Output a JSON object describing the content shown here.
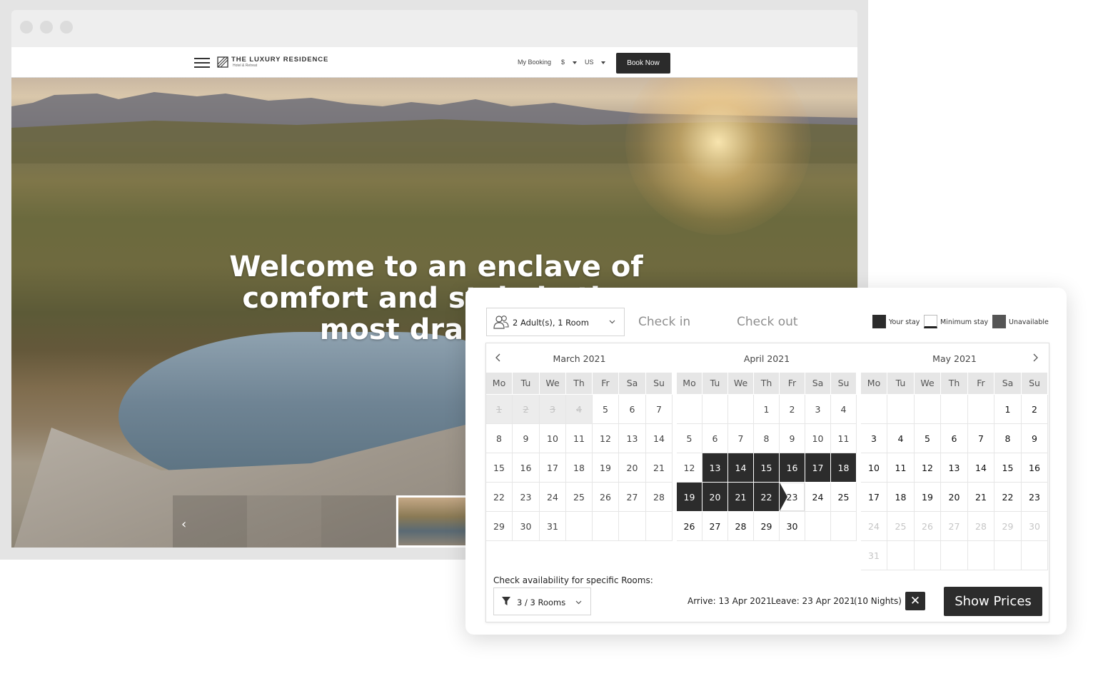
{
  "site": {
    "logo_title": "THE LUXURY RESIDENCE",
    "logo_subtitle": "Hotel & Retreat",
    "nav": {
      "my_booking": "My Booking",
      "currency": "$",
      "language": "US",
      "book_now": "Book Now"
    },
    "hero_title": "Welcome to an enclave of comfort and style in the most dramatic"
  },
  "booking": {
    "guests_label": "2 Adult(s), 1 Room",
    "check_in_placeholder": "Check in",
    "check_out_placeholder": "Check out",
    "legend": {
      "your_stay": "Your stay",
      "minimum_stay": "Minimum stay",
      "unavailable": "Unavailable"
    },
    "weekdays": [
      "Mo",
      "Tu",
      "We",
      "Th",
      "Fr",
      "Sa",
      "Su"
    ],
    "months": [
      {
        "title": "March 2021",
        "weeks": [
          [
            {
              "d": ""
            },
            {
              "d": "1",
              "s": "past"
            },
            {
              "d": "2",
              "s": "past"
            },
            {
              "d": "3",
              "s": "past"
            },
            {
              "d": "4",
              "s": "past"
            },
            {
              "d": "5"
            },
            {
              "d": "6"
            },
            {
              "d": "7"
            }
          ],
          [
            {
              "d": "8"
            },
            {
              "d": "9"
            },
            {
              "d": "10"
            },
            {
              "d": "11"
            },
            {
              "d": "12"
            },
            {
              "d": "13"
            },
            {
              "d": "14"
            }
          ],
          [
            {
              "d": "15"
            },
            {
              "d": "16"
            },
            {
              "d": "17"
            },
            {
              "d": "18"
            },
            {
              "d": "19"
            },
            {
              "d": "20"
            },
            {
              "d": "21"
            }
          ],
          [
            {
              "d": "22"
            },
            {
              "d": "23"
            },
            {
              "d": "24"
            },
            {
              "d": "25"
            },
            {
              "d": "26"
            },
            {
              "d": "27"
            },
            {
              "d": "28"
            }
          ],
          [
            {
              "d": "29"
            },
            {
              "d": "30"
            },
            {
              "d": "31"
            },
            {
              "d": ""
            },
            {
              "d": ""
            },
            {
              "d": ""
            },
            {
              "d": ""
            }
          ]
        ]
      },
      {
        "title": "April 2021",
        "weeks": [
          [
            {
              "d": ""
            },
            {
              "d": ""
            },
            {
              "d": ""
            },
            {
              "d": "1"
            },
            {
              "d": "2"
            },
            {
              "d": "3"
            },
            {
              "d": "4"
            }
          ],
          [
            {
              "d": "5"
            },
            {
              "d": "6"
            },
            {
              "d": "7"
            },
            {
              "d": "8"
            },
            {
              "d": "9"
            },
            {
              "d": "10"
            },
            {
              "d": "11"
            }
          ],
          [
            {
              "d": "12"
            },
            {
              "d": "13",
              "s": "stay"
            },
            {
              "d": "14",
              "s": "stay"
            },
            {
              "d": "15",
              "s": "stay"
            },
            {
              "d": "16",
              "s": "stay"
            },
            {
              "d": "17",
              "s": "stay"
            },
            {
              "d": "18",
              "s": "stay"
            }
          ],
          [
            {
              "d": "19",
              "s": "stay"
            },
            {
              "d": "20",
              "s": "stay"
            },
            {
              "d": "21",
              "s": "stay"
            },
            {
              "d": "22",
              "s": "stay"
            },
            {
              "d": "23",
              "s": "min"
            },
            {
              "d": "24",
              "s": "strong"
            },
            {
              "d": "25",
              "s": "strong"
            }
          ],
          [
            {
              "d": "26",
              "s": "strong"
            },
            {
              "d": "27",
              "s": "strong"
            },
            {
              "d": "28",
              "s": "strong"
            },
            {
              "d": "29",
              "s": "strong"
            },
            {
              "d": "30",
              "s": "strong"
            },
            {
              "d": ""
            },
            {
              "d": ""
            }
          ]
        ]
      },
      {
        "title": "May 2021",
        "weeks": [
          [
            {
              "d": ""
            },
            {
              "d": ""
            },
            {
              "d": ""
            },
            {
              "d": ""
            },
            {
              "d": ""
            },
            {
              "d": "1",
              "s": "strong"
            },
            {
              "d": "2",
              "s": "strong"
            }
          ],
          [
            {
              "d": "3",
              "s": "strong"
            },
            {
              "d": "4",
              "s": "strong"
            },
            {
              "d": "5",
              "s": "strong"
            },
            {
              "d": "6",
              "s": "strong"
            },
            {
              "d": "7",
              "s": "strong"
            },
            {
              "d": "8",
              "s": "strong"
            },
            {
              "d": "9",
              "s": "strong"
            }
          ],
          [
            {
              "d": "10",
              "s": "strong"
            },
            {
              "d": "11",
              "s": "strong"
            },
            {
              "d": "12",
              "s": "strong"
            },
            {
              "d": "13",
              "s": "strong"
            },
            {
              "d": "14",
              "s": "strong"
            },
            {
              "d": "15",
              "s": "strong"
            },
            {
              "d": "16",
              "s": "strong"
            }
          ],
          [
            {
              "d": "17",
              "s": "strong"
            },
            {
              "d": "18",
              "s": "strong"
            },
            {
              "d": "19",
              "s": "strong"
            },
            {
              "d": "20",
              "s": "strong"
            },
            {
              "d": "21",
              "s": "strong"
            },
            {
              "d": "22",
              "s": "strong"
            },
            {
              "d": "23",
              "s": "strong"
            }
          ],
          [
            {
              "d": "24",
              "s": "dim"
            },
            {
              "d": "25",
              "s": "dim"
            },
            {
              "d": "26",
              "s": "dim"
            },
            {
              "d": "27",
              "s": "dim"
            },
            {
              "d": "28",
              "s": "dim"
            },
            {
              "d": "29",
              "s": "dim"
            },
            {
              "d": "30",
              "s": "dim"
            }
          ],
          [
            {
              "d": "31",
              "s": "dim"
            },
            {
              "d": ""
            },
            {
              "d": ""
            },
            {
              "d": ""
            },
            {
              "d": ""
            },
            {
              "d": ""
            },
            {
              "d": ""
            }
          ]
        ]
      }
    ],
    "availability_label": "Check availability for specific Rooms:",
    "rooms_filter": "3 / 3 Rooms",
    "arrive": "Arrive: 13 Apr 2021",
    "leave": "Leave: 23 Apr 2021",
    "nights": "(10 Nights)",
    "clear_symbol": "✕",
    "show_prices": "Show Prices"
  },
  "colors": {
    "stay": "#2c2c2c",
    "unavailable": "#555555",
    "weekday_header": "#e6e6e6",
    "past_day": "#ececec"
  }
}
